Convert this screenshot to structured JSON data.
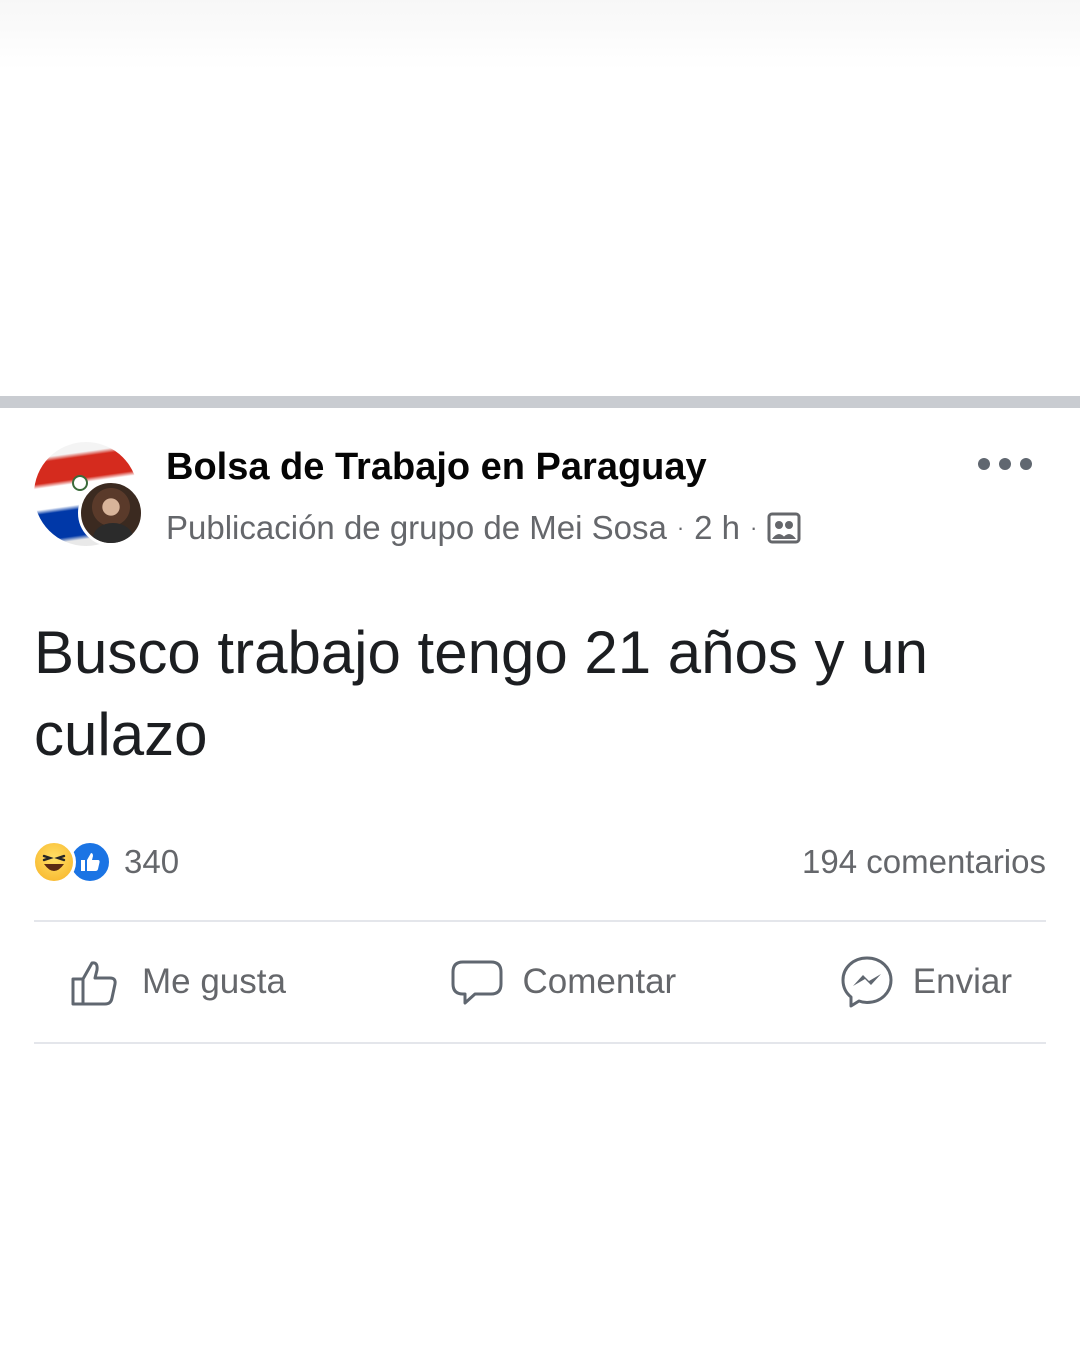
{
  "post": {
    "group_name": "Bolsa de Trabajo en Paraguay",
    "meta_text": "Publicación de grupo de Mei Sosa",
    "time": "2 h",
    "dot": "·",
    "text": "Busco trabajo tengo 21 años y un culazo",
    "reactions": {
      "icons": [
        "haha-icon",
        "like-icon"
      ],
      "count": "340"
    },
    "comments_count": "194 comentarios",
    "actions": {
      "like_label": "Me gusta",
      "comment_label": "Comentar",
      "send_label": "Enviar"
    }
  },
  "colors": {
    "primary_text": "#050505",
    "secondary_text": "#65676b",
    "like_blue": "#1b74e4",
    "separator": "#c9ccd1"
  }
}
